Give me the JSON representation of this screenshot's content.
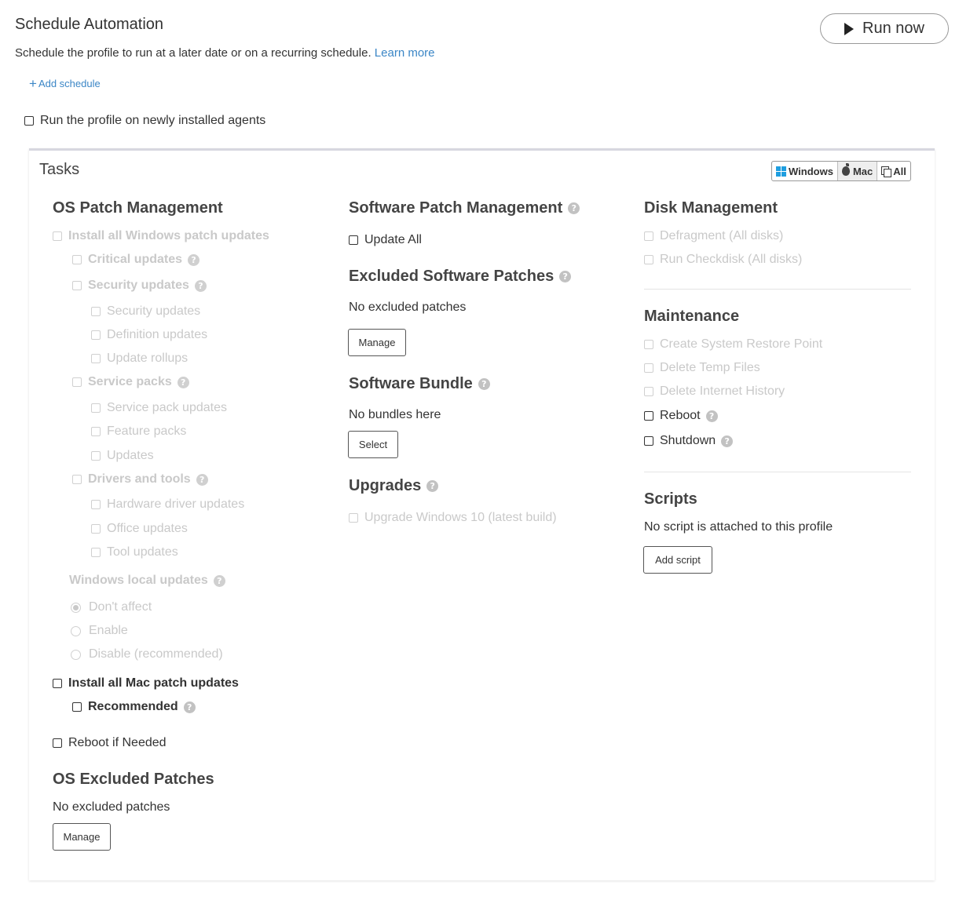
{
  "header": {
    "title": "Schedule Automation",
    "description": "Schedule the profile to run at a later date or on a recurring schedule.",
    "learn_more": "Learn more",
    "add_schedule": "Add schedule",
    "run_now": "Run now",
    "run_new_agents": "Run the profile on newly installed agents"
  },
  "tasks": {
    "title": "Tasks",
    "os_filter": {
      "windows": "Windows",
      "mac": "Mac",
      "all": "All",
      "selected": "Mac"
    }
  },
  "os_patch": {
    "title": "OS Patch Management",
    "install_all_windows": "Install all Windows patch updates",
    "critical": "Critical updates",
    "security": "Security updates",
    "security_sub": [
      "Security updates",
      "Definition updates",
      "Update rollups"
    ],
    "service_packs": "Service packs",
    "service_sub": [
      "Service pack updates",
      "Feature packs",
      "Updates"
    ],
    "drivers": "Drivers and tools",
    "drivers_sub": [
      "Hardware driver updates",
      "Office updates",
      "Tool updates"
    ],
    "local_updates": "Windows local updates",
    "local_options": [
      "Don't affect",
      "Enable",
      "Disable (recommended)"
    ],
    "local_selected": "Don't affect",
    "install_all_mac": "Install all Mac patch updates",
    "recommended": "Recommended",
    "reboot_if_needed": "Reboot if Needed"
  },
  "os_excluded": {
    "title": "OS Excluded Patches",
    "empty": "No excluded patches",
    "manage": "Manage"
  },
  "software_patch": {
    "title": "Software Patch Management",
    "update_all": "Update All"
  },
  "excluded_software": {
    "title": "Excluded Software Patches",
    "empty": "No excluded patches",
    "manage": "Manage"
  },
  "bundle": {
    "title": "Software Bundle",
    "empty": "No bundles here",
    "select": "Select"
  },
  "upgrades": {
    "title": "Upgrades",
    "upgrade_win10": "Upgrade Windows 10 (latest build)"
  },
  "disk": {
    "title": "Disk Management",
    "defragment": "Defragment (All disks)",
    "checkdisk": "Run Checkdisk (All disks)"
  },
  "maintenance": {
    "title": "Maintenance",
    "restore_point": "Create System Restore Point",
    "temp_files": "Delete Temp Files",
    "internet_history": "Delete Internet History",
    "reboot": "Reboot",
    "shutdown": "Shutdown"
  },
  "scripts": {
    "title": "Scripts",
    "empty": "No script is attached to this profile",
    "add": "Add script"
  },
  "help_glyph": "?"
}
